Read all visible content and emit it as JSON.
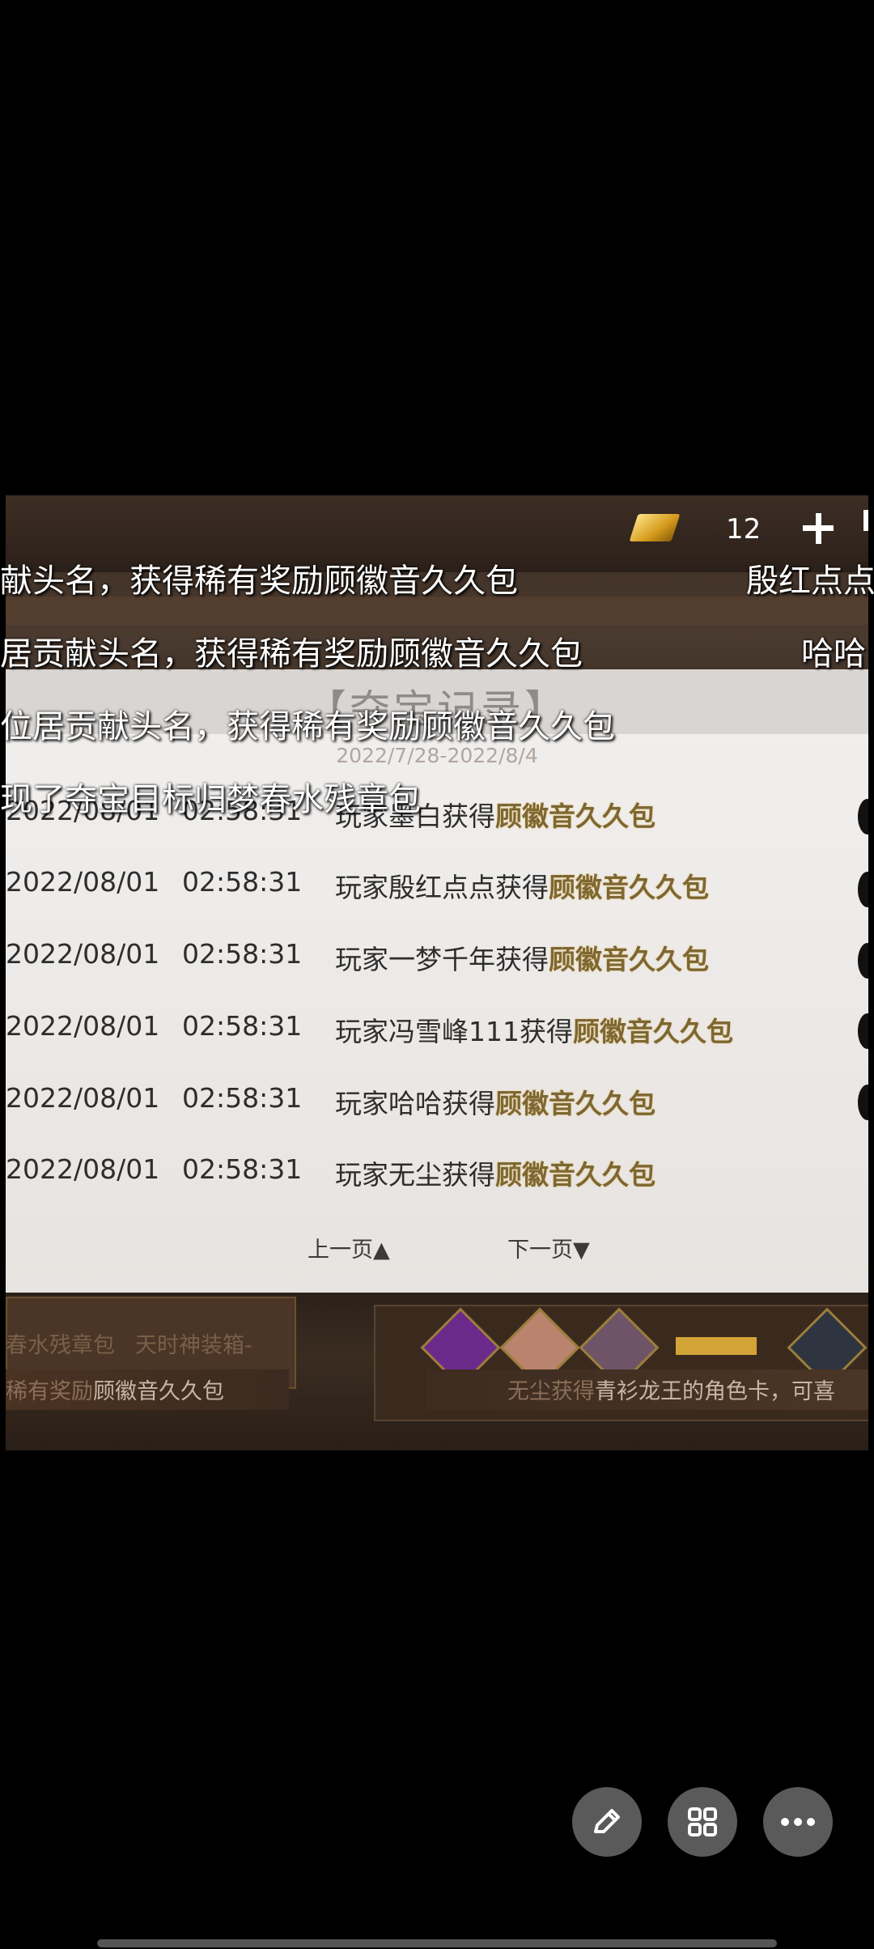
{
  "currency": {
    "value": "12",
    "icon": "gold-ingot-icon"
  },
  "bullets": [
    {
      "left": "献头名，获得稀有奖励顾徽音久久包",
      "right": "殷红点点"
    },
    {
      "left": "居贡献头名，获得稀有奖励顾徽音久久包",
      "right": "哈哈"
    },
    {
      "left": "位居贡献头名，获得稀有奖励顾徽音久久包",
      "right": ""
    },
    {
      "left": "现了夺宝目标归梦春水残章包",
      "right": ""
    }
  ],
  "dialog": {
    "title": "【夺宝记录】",
    "date_range": "2022/7/28-2022/8/4",
    "records": [
      {
        "date": "2022/08/01",
        "time": "02:58:31",
        "prefix": "玩家墨白获得",
        "item": "顾徽音久久包"
      },
      {
        "date": "2022/08/01",
        "time": "02:58:31",
        "prefix": "玩家殷红点点获得",
        "item": "顾徽音久久包"
      },
      {
        "date": "2022/08/01",
        "time": "02:58:31",
        "prefix": "玩家一梦千年获得",
        "item": "顾徽音久久包"
      },
      {
        "date": "2022/08/01",
        "time": "02:58:31",
        "prefix": "玩家冯雪峰111获得",
        "item": "顾徽音久久包"
      },
      {
        "date": "2022/08/01",
        "time": "02:58:31",
        "prefix": "玩家哈哈获得",
        "item": "顾徽音久久包"
      },
      {
        "date": "2022/08/01",
        "time": "02:58:31",
        "prefix": "玩家无尘获得",
        "item": "顾徽音久久包"
      }
    ],
    "prev_page": "上一页▲",
    "next_page": "下一页▼"
  },
  "bottom": {
    "left_card_label": "春水残章包",
    "left_card_label2": "天时神装箱-",
    "left_banner_prefix": "稀有奖励",
    "left_banner_item": "顾徽音久久包",
    "right_banner_prefix": "无尘获得",
    "right_banner_item": "青衫龙王的角色卡，可喜"
  },
  "fabs": [
    "edit-icon",
    "grid-icon",
    "more-icon"
  ]
}
